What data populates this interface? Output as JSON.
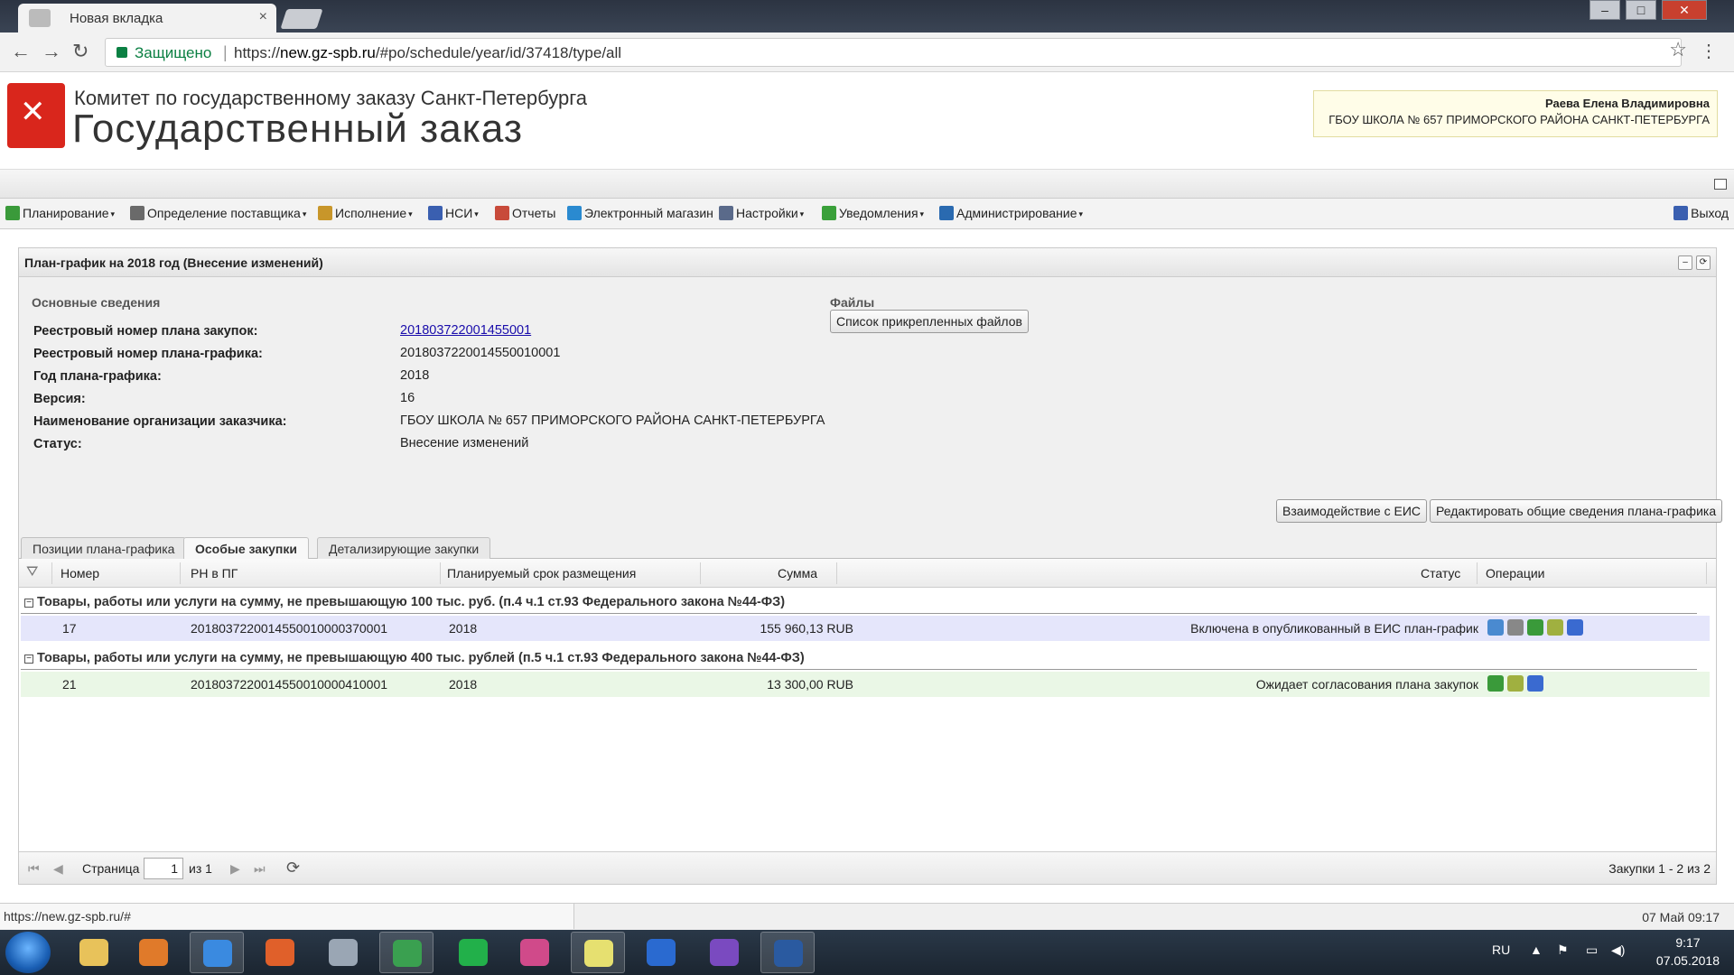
{
  "browser": {
    "tab_title": "Новая вкладка",
    "tab_close": "×",
    "secure_label": "Защищено",
    "url_scheme": "https://",
    "url_host": "new.gz-spb.ru",
    "url_path": "/#po/schedule/year/id/37418/type/all",
    "back_icon": "←",
    "forward_icon": "→",
    "reload_icon": "↻",
    "star_icon": "☆",
    "menu_icon": "⋮",
    "win_min": "–",
    "win_max": "□",
    "win_close": "✕"
  },
  "header": {
    "org_name": "Комитет по государственному заказу Санкт-Петербурга",
    "site_title": "Государственный заказ",
    "user_name": "Раева Елена Владимировна",
    "user_org": "ГБОУ ШКОЛА № 657 ПРИМОРСКОГО РАЙОНА САНКТ-ПЕТЕРБУРГА"
  },
  "menu": {
    "items": [
      {
        "label": "Планирование",
        "dropdown": true,
        "icon": "planning-icon",
        "color": "#3a9a3a"
      },
      {
        "label": "Определение поставщика",
        "dropdown": true,
        "icon": "gears-icon",
        "color": "#6a6a6a"
      },
      {
        "label": "Исполнение",
        "dropdown": true,
        "icon": "folder-icon",
        "color": "#c8962a"
      },
      {
        "label": "НСИ",
        "dropdown": true,
        "icon": "book-icon",
        "color": "#3a5fb0"
      },
      {
        "label": "Отчеты",
        "dropdown": false,
        "icon": "report-icon",
        "color": "#c84a3a"
      },
      {
        "label": "Электронный магазин",
        "dropdown": false,
        "icon": "cart-icon",
        "color": "#2a8ad0"
      },
      {
        "label": "Настройки",
        "dropdown": true,
        "icon": "wrench-icon",
        "color": "#5a6a8a"
      },
      {
        "label": "Уведомления",
        "dropdown": true,
        "icon": "bag-icon",
        "color": "#3aa03a"
      },
      {
        "label": "Администрирование",
        "dropdown": true,
        "icon": "user-icon",
        "color": "#2a6ab0"
      }
    ],
    "caret": "▾",
    "logout": "Выход"
  },
  "panel": {
    "title": "План-график на 2018 год (Внесение изменений)",
    "basic_section": "Основные сведения",
    "files_section": "Файлы",
    "files_button": "Список прикрепленных файлов",
    "fields": [
      {
        "label": "Реестровый номер плана закупок:",
        "value": "201803722001455001",
        "link": true
      },
      {
        "label": "Реестровый номер плана-графика:",
        "value": "2018037220014550010001",
        "link": false
      },
      {
        "label": "Год плана-графика:",
        "value": "2018",
        "link": false
      },
      {
        "label": "Версия:",
        "value": "16",
        "link": false
      },
      {
        "label": "Наименование организации заказчика:",
        "value": "ГБОУ ШКОЛА № 657 ПРИМОРСКОГО РАЙОНА САНКТ-ПЕТЕРБУРГА",
        "link": false
      },
      {
        "label": "Статус:",
        "value": "Внесение изменений",
        "link": false
      }
    ],
    "btn_eis": "Взаимодействие с ЕИС",
    "btn_edit": "Редактировать общие сведения плана-графика",
    "tabs": [
      "Позиции плана-графика",
      "Особые закупки",
      "Детализирующие закупки"
    ],
    "active_tab": 1
  },
  "grid": {
    "columns": [
      "Номер",
      "РН в ПГ",
      "Планируемый срок размещения",
      "Сумма",
      "Статус",
      "Операции"
    ],
    "groups": [
      {
        "title": "Товары, работы или услуги на сумму, не превышающую 100 тыс. руб. (п.4 ч.1 ст.93 Федерального закона №44-ФЗ)",
        "rows": [
          {
            "number": "17",
            "rn": "2018037220014550010000370001",
            "term": "2018",
            "sum": "155 960,13 RUB",
            "status": "Включена в опубликованный в ЕИС план-график"
          }
        ]
      },
      {
        "title": "Товары, работы или услуги на сумму, не превышающую 400 тыс. рублей (п.5 ч.1 ст.93 Федерального закона №44-ФЗ)",
        "rows": [
          {
            "number": "21",
            "rn": "2018037220014550010000410001",
            "term": "2018",
            "sum": "13 300,00 RUB",
            "status": "Ожидает согласования плана закупок"
          }
        ]
      }
    ],
    "minus": "⊟"
  },
  "pager": {
    "page_label": "Страница",
    "page_value": "1",
    "of_label": "из 1",
    "summary": "Закупки 1 - 2 из 2",
    "first": "⏮",
    "prev": "◀",
    "next": "▶",
    "last": "⏭",
    "refresh": "⟳"
  },
  "statusbar": {
    "url": "https://new.gz-spb.ru/#",
    "datetime": "07 Май 09:17"
  },
  "taskbar": {
    "lang": "RU",
    "time": "9:17",
    "date": "07.05.2018",
    "apps": [
      {
        "name": "explorer-icon",
        "color": "#e8c25a"
      },
      {
        "name": "media-player-icon",
        "color": "#e07a2a"
      },
      {
        "name": "ie-icon",
        "color": "#3a8ae0"
      },
      {
        "name": "firefox-icon",
        "color": "#e0602a"
      },
      {
        "name": "calculator-icon",
        "color": "#9aa6b4"
      },
      {
        "name": "chrome-icon",
        "color": "#3aa050"
      },
      {
        "name": "mail-agent-icon",
        "color": "#22b04a"
      },
      {
        "name": "paint-icon",
        "color": "#d04a8a"
      },
      {
        "name": "sticky-notes-icon",
        "color": "#e6e070"
      },
      {
        "name": "outlook-icon",
        "color": "#2a6ad0"
      },
      {
        "name": "viber-icon",
        "color": "#7a4ac0"
      },
      {
        "name": "mcafee-icon",
        "color": "#2a5aa0"
      }
    ]
  }
}
